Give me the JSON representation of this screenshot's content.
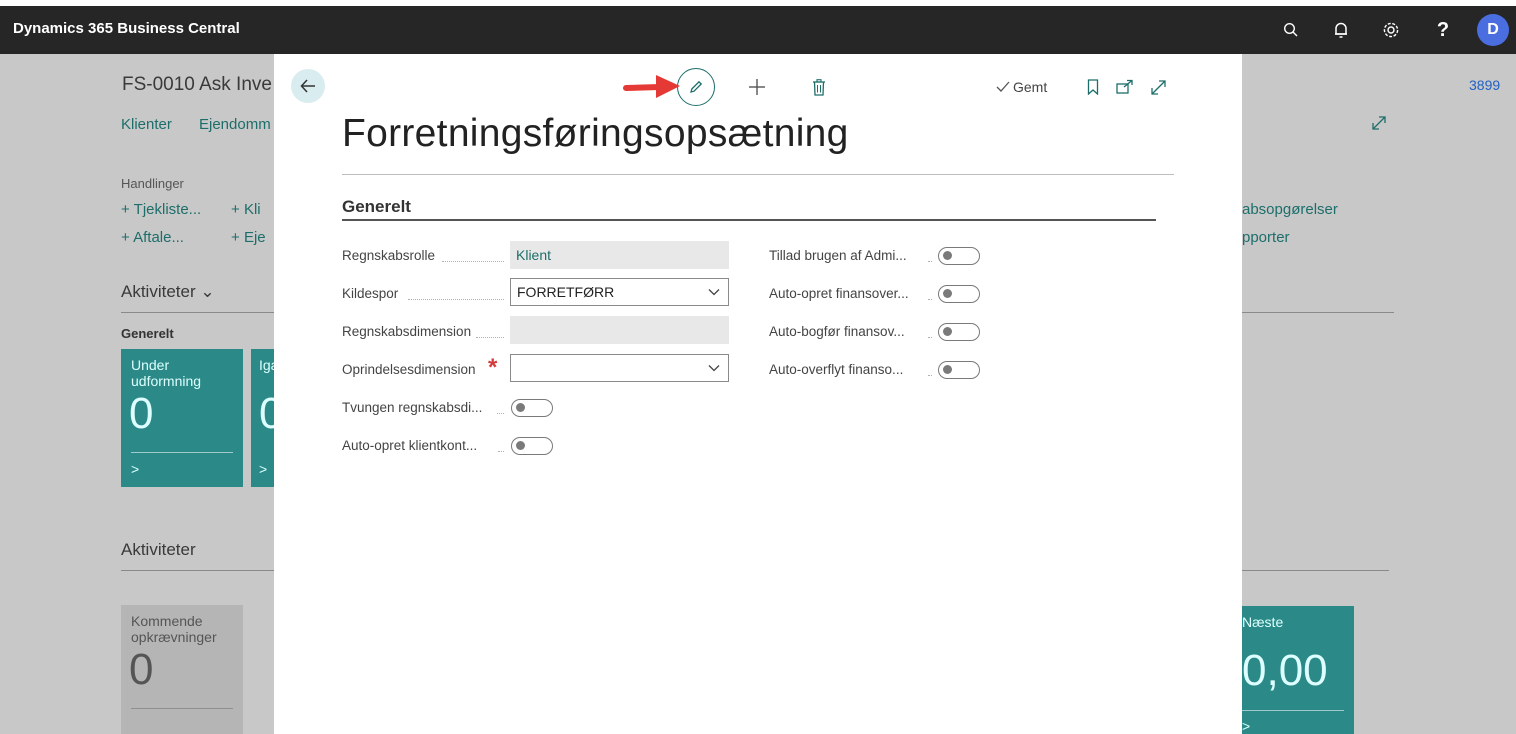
{
  "app": {
    "title": "Dynamics 365 Business Central",
    "avatar_letter": "D"
  },
  "background_page": {
    "title": "FS-0010 Ask Inve",
    "nav": [
      "Klienter",
      "Ejendomm"
    ],
    "actions_heading": "Handlinger",
    "actions": [
      "Tjekliste...",
      "Kli",
      "Aftale...",
      "Eje"
    ],
    "activities_heading": "Aktiviteter",
    "group_label": "Generelt",
    "tile1": {
      "label": "Under udformning",
      "value": "0",
      "arrow": ">"
    },
    "tile2": {
      "label": "Iga",
      "value": "0",
      "arrow": ">"
    },
    "activities_heading2": "Aktiviteter",
    "tile3": {
      "label": "Kommende opkrævninger",
      "value": "0"
    },
    "right_links": [
      "absopgørelser",
      "pporter"
    ],
    "right_number": "3899",
    "tile4": {
      "label": "Næste",
      "value": "0,00",
      "arrow": ">"
    }
  },
  "dialog": {
    "saved_label": "Gemt",
    "title": "Forretningsføringsopsætning",
    "section": "Generelt",
    "left_fields": [
      {
        "label": "Regnskabsrolle",
        "value": "Klient"
      },
      {
        "label": "Kildespor",
        "value": "FORRETFØRR"
      },
      {
        "label": "Regnskabsdimension",
        "value": ""
      },
      {
        "label": "Oprindelsesdimension",
        "value": "",
        "required_mark": "*"
      },
      {
        "label": "Tvungen regnskabsdi...",
        "toggle": false
      },
      {
        "label": "Auto-opret klientkont...",
        "toggle": false
      }
    ],
    "right_fields": [
      {
        "label": "Tillad brugen af Admi...",
        "toggle": false
      },
      {
        "label": "Auto-opret finansover...",
        "toggle": false
      },
      {
        "label": "Auto-bogfør finansov...",
        "toggle": false
      },
      {
        "label": "Auto-overflyt finanso...",
        "toggle": false
      }
    ]
  },
  "colors": {
    "accent": "#1d6e6a",
    "navbar": "#262626",
    "tile": "#2b8a88",
    "required": "#d23b3b"
  }
}
